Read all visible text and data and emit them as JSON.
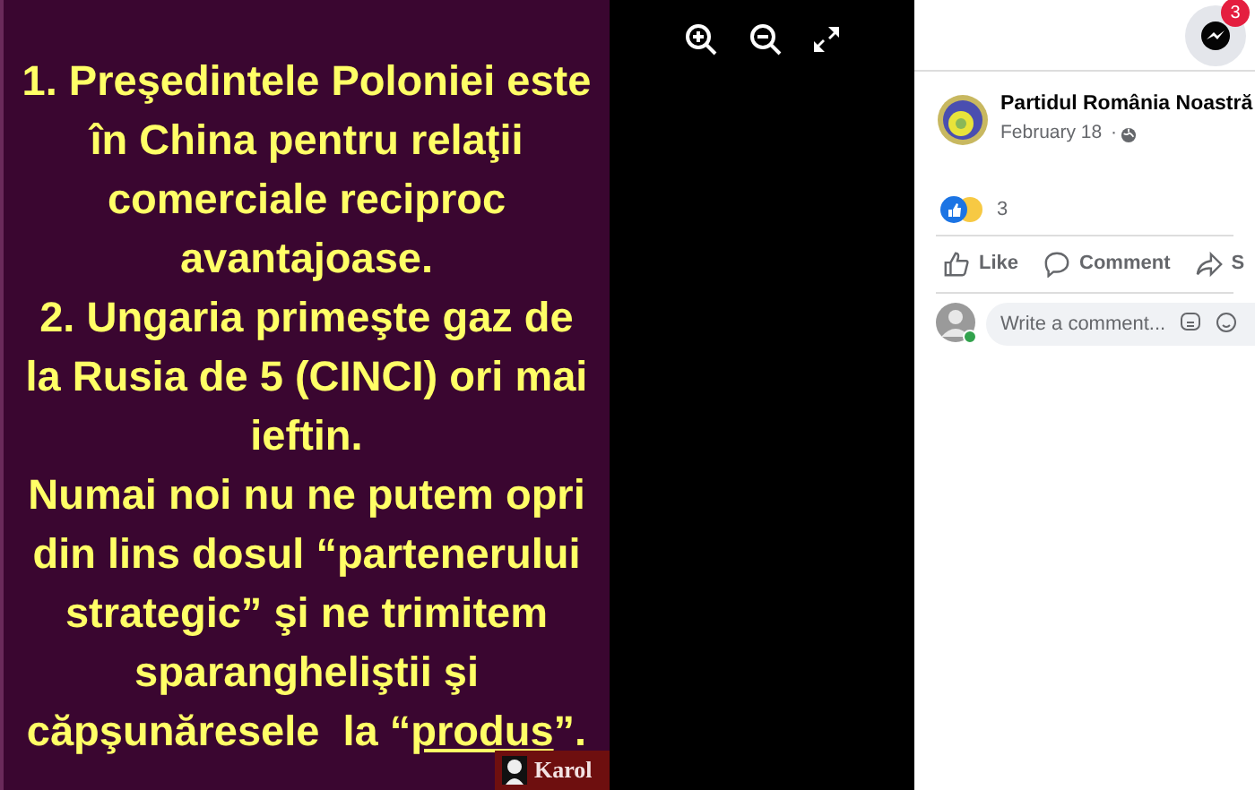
{
  "image_text": {
    "lines": [
      {
        "segments": [
          {
            "text": "1. Preşedintele Poloniei este",
            "underline": false
          }
        ]
      },
      {
        "segments": [
          {
            "text": "în China pentru relaţii",
            "underline": false
          }
        ]
      },
      {
        "segments": [
          {
            "text": "comerciale reciproc",
            "underline": false
          }
        ]
      },
      {
        "segments": [
          {
            "text": "avantajoase.",
            "underline": false
          }
        ]
      },
      {
        "segments": [
          {
            "text": "2. Ungaria primeşte gaz de",
            "underline": false
          }
        ]
      },
      {
        "segments": [
          {
            "text": "la Rusia de 5 (CINCI) ori mai",
            "underline": false
          }
        ]
      },
      {
        "segments": [
          {
            "text": "ieftin.",
            "underline": false
          }
        ]
      },
      {
        "segments": [
          {
            "text": "Numai noi nu ne putem opri",
            "underline": false
          }
        ]
      },
      {
        "segments": [
          {
            "text": "din lins dosul “partenerului",
            "underline": false
          }
        ]
      },
      {
        "segments": [
          {
            "text": "strategic” şi ne trimitem",
            "underline": false
          }
        ]
      },
      {
        "segments": [
          {
            "text": "sparangheliştii şi",
            "underline": false
          }
        ]
      },
      {
        "segments": [
          {
            "text": "căpşunăresele  la “",
            "underline": false
          },
          {
            "text": "produs",
            "underline": true
          },
          {
            "text": "”.",
            "underline": false
          }
        ]
      }
    ],
    "signature": "Karol"
  },
  "messenger": {
    "badge": "3"
  },
  "post": {
    "author": "Partidul România Noastră",
    "date": "February 18",
    "date_separator": "·",
    "reaction_count": "3",
    "actions": [
      {
        "kind": "like",
        "label": "Like"
      },
      {
        "kind": "comment",
        "label": "Comment"
      },
      {
        "kind": "share",
        "label": "S"
      }
    ],
    "comment_placeholder": "Write a comment..."
  }
}
